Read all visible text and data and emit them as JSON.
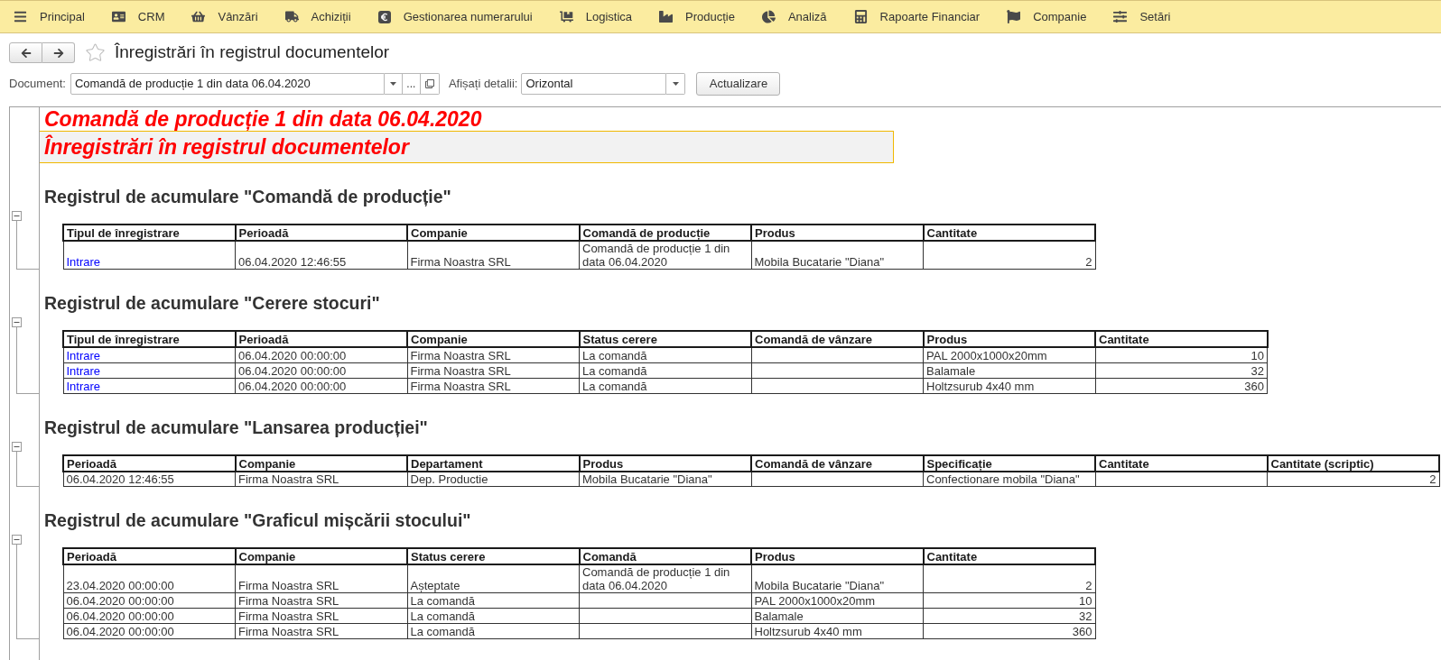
{
  "menu": [
    {
      "label": "Principal"
    },
    {
      "label": "CRM"
    },
    {
      "label": "Vânzări"
    },
    {
      "label": "Achiziții"
    },
    {
      "label": "Gestionarea numerarului"
    },
    {
      "label": "Logistica"
    },
    {
      "label": "Producție"
    },
    {
      "label": "Analiză"
    },
    {
      "label": "Rapoarte Financiar"
    },
    {
      "label": "Companie"
    },
    {
      "label": "Setări"
    }
  ],
  "toolbar": {
    "title": "Înregistrări în registrul documentelor"
  },
  "filters": {
    "document": {
      "label": "Document:",
      "value": "Comandă de producție 1 din data 06.04.2020",
      "select_button": "..."
    },
    "details": {
      "label": "Afișați detalii:",
      "value": "Orizontal"
    },
    "refresh_button": "Actualizare"
  },
  "report": {
    "title": "Comandă de producție 1 din data 06.04.2020",
    "subtitle": "Înregistrări în registrul documentelor",
    "sections": [
      {
        "heading": "Registrul de acumulare \"Comandă de producție\"",
        "expanded": true,
        "columns": [
          {
            "label": "Tipul de înregistrare",
            "kind": "link"
          },
          {
            "label": "Perioadă",
            "kind": "text"
          },
          {
            "label": "Companie",
            "kind": "text"
          },
          {
            "label": "Comandă de producție",
            "kind": "text"
          },
          {
            "label": "Produs",
            "kind": "text"
          },
          {
            "label": "Cantitate",
            "kind": "number"
          }
        ],
        "rows": [
          [
            "Intrare",
            "06.04.2020 12:46:55",
            "Firma Noastra SRL",
            "Comandă de producție 1 din data 06.04.2020",
            "Mobila Bucatarie \"Diana\"",
            "2"
          ]
        ]
      },
      {
        "heading": "Registrul de acumulare \"Cerere stocuri\"",
        "expanded": true,
        "columns": [
          {
            "label": "Tipul de înregistrare",
            "kind": "link"
          },
          {
            "label": "Perioadă",
            "kind": "text"
          },
          {
            "label": "Companie",
            "kind": "text"
          },
          {
            "label": "Status cerere",
            "kind": "text"
          },
          {
            "label": "Comandă de vânzare",
            "kind": "text"
          },
          {
            "label": "Produs",
            "kind": "text"
          },
          {
            "label": "Cantitate",
            "kind": "number"
          }
        ],
        "rows": [
          [
            "Intrare",
            "06.04.2020 00:00:00",
            "Firma Noastra SRL",
            "La comandă",
            null,
            "PAL 2000x1000x20mm",
            "10"
          ],
          [
            "Intrare",
            "06.04.2020 00:00:00",
            "Firma Noastra SRL",
            "La comandă",
            null,
            "Balamale",
            "32"
          ],
          [
            "Intrare",
            "06.04.2020 00:00:00",
            "Firma Noastra SRL",
            "La comandă",
            null,
            "Holtzsurub 4x40 mm",
            "360"
          ]
        ]
      },
      {
        "heading": "Registrul de acumulare \"Lansarea producției\"",
        "expanded": true,
        "columns": [
          {
            "label": "Perioadă",
            "kind": "text"
          },
          {
            "label": "Companie",
            "kind": "text"
          },
          {
            "label": "Departament",
            "kind": "text"
          },
          {
            "label": "Produs",
            "kind": "text"
          },
          {
            "label": "Comandă de vânzare",
            "kind": "text"
          },
          {
            "label": "Specificație",
            "kind": "text"
          },
          {
            "label": "Cantitate",
            "kind": "number"
          },
          {
            "label": "Cantitate (scriptic)",
            "kind": "number"
          }
        ],
        "rows": [
          [
            "06.04.2020 12:46:55",
            "Firma Noastra SRL",
            "Dep. Productie",
            "Mobila Bucatarie \"Diana\"",
            null,
            "Confectionare mobila \"Diana\"",
            null,
            "2"
          ]
        ]
      },
      {
        "heading": "Registrul de acumulare \"Graficul mișcării stocului\"",
        "expanded": true,
        "columns": [
          {
            "label": "Perioadă",
            "kind": "text"
          },
          {
            "label": "Companie",
            "kind": "text"
          },
          {
            "label": "Status cerere",
            "kind": "text"
          },
          {
            "label": "Comandă",
            "kind": "text"
          },
          {
            "label": "Produs",
            "kind": "text"
          },
          {
            "label": "Cantitate",
            "kind": "number"
          }
        ],
        "rows": [
          [
            "23.04.2020 00:00:00",
            "Firma Noastra SRL",
            "Așteptate",
            "Comandă de producție 1 din data 06.04.2020",
            "Mobila Bucatarie \"Diana\"",
            "2"
          ],
          [
            "06.04.2020 00:00:00",
            "Firma Noastra SRL",
            "La comandă",
            null,
            "PAL 2000x1000x20mm",
            "10"
          ],
          [
            "06.04.2020 00:00:00",
            "Firma Noastra SRL",
            "La comandă",
            null,
            "Balamale",
            "32"
          ],
          [
            "06.04.2020 00:00:00",
            "Firma Noastra SRL",
            "La comandă",
            null,
            "Holtzsurub 4x40 mm",
            "360"
          ]
        ]
      }
    ]
  }
}
